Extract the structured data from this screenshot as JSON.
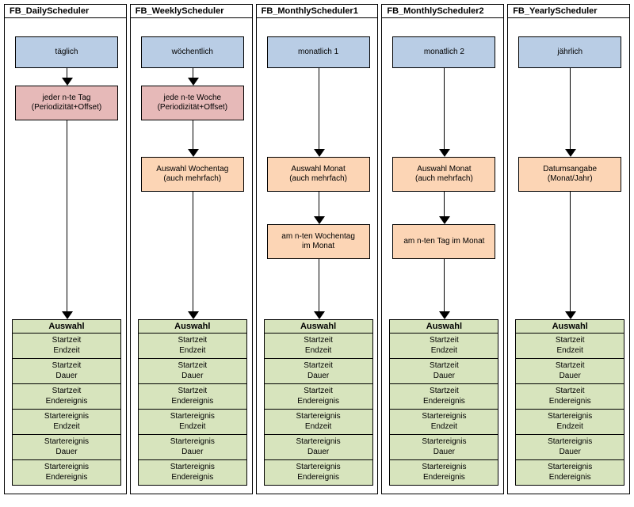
{
  "columns": [
    {
      "title": "FB_DailyScheduler",
      "blue": "täglich",
      "red_line1": "jeder n-te Tag",
      "red_line2": "(Periodizität+Offset)",
      "orange1_line1": null,
      "orange1_line2": null,
      "orange2_line1": null,
      "orange2_line2": null,
      "has_red": true,
      "has_orange1": false,
      "has_orange2": false
    },
    {
      "title": "FB_WeeklyScheduler",
      "blue": "wöchentlich",
      "red_line1": "jede n-te Woche",
      "red_line2": "(Periodizität+Offset)",
      "orange1_line1": "Auswahl Wochentag",
      "orange1_line2": "(auch mehrfach)",
      "orange2_line1": null,
      "orange2_line2": null,
      "has_red": true,
      "has_orange1": true,
      "has_orange2": false
    },
    {
      "title": "FB_MonthlyScheduler1",
      "blue": "monatlich 1",
      "red_line1": null,
      "red_line2": null,
      "orange1_line1": "Auswahl Monat",
      "orange1_line2": "(auch mehrfach)",
      "orange2_line1": "am n-ten Wochentag",
      "orange2_line2": "im Monat",
      "has_red": false,
      "has_orange1": true,
      "has_orange2": true
    },
    {
      "title": "FB_MonthlyScheduler2",
      "blue": "monatlich 2",
      "red_line1": null,
      "red_line2": null,
      "orange1_line1": "Auswahl Monat",
      "orange1_line2": "(auch mehrfach)",
      "orange2_line1": "am n-ten Tag im Monat",
      "orange2_line2": null,
      "has_red": false,
      "has_orange1": true,
      "has_orange2": true
    },
    {
      "title": "FB_YearlyScheduler",
      "blue": "jährlich",
      "red_line1": null,
      "red_line2": null,
      "orange1_line1": "Datumsangabe",
      "orange1_line2": "(Monat/Jahr)",
      "orange2_line1": null,
      "orange2_line2": null,
      "has_red": false,
      "has_orange1": true,
      "has_orange2": false
    }
  ],
  "auswahl_header": "Auswahl",
  "auswahl_options": [
    [
      "Startzeit",
      "Endzeit"
    ],
    [
      "Startzeit",
      "Dauer"
    ],
    [
      "Startzeit",
      "Endereignis"
    ],
    [
      "Startereignis",
      "Endzeit"
    ],
    [
      "Startereignis",
      "Dauer"
    ],
    [
      "Startereignis",
      "Endereignis"
    ]
  ]
}
